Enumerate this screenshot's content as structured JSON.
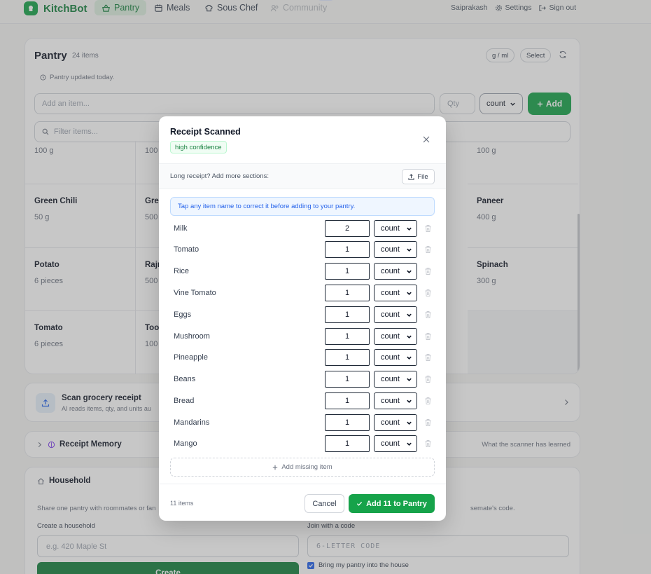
{
  "nav": {
    "brand": "KitchBot",
    "tabs": [
      {
        "label": "Pantry",
        "icon": "basket-icon"
      },
      {
        "label": "Meals",
        "icon": "calendar-icon"
      },
      {
        "label": "Sous Chef",
        "icon": "chef-hat-icon"
      },
      {
        "label": "Community",
        "icon": "users-icon",
        "badge": "soon"
      }
    ],
    "user": "Saiprakash",
    "settings": "Settings",
    "signout": "Sign out"
  },
  "pantry": {
    "title": "Pantry",
    "count": "24 items",
    "units_toggle": "g / ml",
    "select": "Select",
    "updated": "Pantry updated today.",
    "add_placeholder": "Add an item...",
    "qty_placeholder": "Qty",
    "unit_value": "count",
    "add_label": "Add",
    "filter_placeholder": "Filter items...",
    "rows": [
      [
        {
          "name": "",
          "qty": "100 g"
        },
        {
          "name": "",
          "qty": "100"
        },
        {
          "name": "",
          "qty": ""
        },
        {
          "name": "",
          "qty": ""
        },
        {
          "name": "",
          "qty": "100 g"
        }
      ],
      [
        {
          "name": "Green Chili",
          "qty": "50 g"
        },
        {
          "name": "Gre",
          "qty": "500"
        },
        {
          "name": "",
          "qty": ""
        },
        {
          "name": "",
          "qty": ""
        },
        {
          "name": "Paneer",
          "qty": "400 g"
        }
      ],
      [
        {
          "name": "Potato",
          "qty": "6 pieces"
        },
        {
          "name": "Rajr",
          "qty": "500"
        },
        {
          "name": "",
          "qty": ""
        },
        {
          "name": "",
          "qty": ""
        },
        {
          "name": "Spinach",
          "qty": "300 g"
        }
      ],
      [
        {
          "name": "Tomato",
          "qty": "6 pieces"
        },
        {
          "name": "Too",
          "qty": "100"
        },
        {
          "name": "",
          "qty": ""
        },
        {
          "name": "",
          "qty": ""
        },
        {
          "name": "",
          "qty": ""
        }
      ]
    ]
  },
  "scan": {
    "title": "Scan grocery receipt",
    "subtitle": "AI reads items, qty, and units au"
  },
  "memory": {
    "title": "Receipt Memory",
    "right": "What the scanner has learned"
  },
  "household": {
    "title": "Household",
    "desc_left": "Share one pantry with roommates or fan",
    "desc_right": "semate's code.",
    "create_label": "Create a household",
    "create_placeholder": "e.g. 420 Maple St",
    "join_label": "Join with a code",
    "join_placeholder": "6-LETTER CODE",
    "create_button": "Create",
    "bring_pantry": "Bring my pantry into the house"
  },
  "modal": {
    "title": "Receipt Scanned",
    "confidence": "high confidence",
    "more_sections": "Long receipt? Add more sections:",
    "file_button": "File",
    "hint": "Tap any item name to correct it before adding to your pantry.",
    "items": [
      {
        "name": "Milk",
        "qty": "2",
        "unit": "count"
      },
      {
        "name": "Tomato",
        "qty": "1",
        "unit": "count"
      },
      {
        "name": "Rice",
        "qty": "1",
        "unit": "count"
      },
      {
        "name": "Vine Tomato",
        "qty": "1",
        "unit": "count"
      },
      {
        "name": "Eggs",
        "qty": "1",
        "unit": "count"
      },
      {
        "name": "Mushroom",
        "qty": "1",
        "unit": "count"
      },
      {
        "name": "Pineapple",
        "qty": "1",
        "unit": "count"
      },
      {
        "name": "Beans",
        "qty": "1",
        "unit": "count"
      },
      {
        "name": "Bread",
        "qty": "1",
        "unit": "count"
      },
      {
        "name": "Mandarins",
        "qty": "1",
        "unit": "count"
      },
      {
        "name": "Mango",
        "qty": "1",
        "unit": "count"
      }
    ],
    "add_missing": "Add missing item",
    "count_text": "11 items",
    "cancel": "Cancel",
    "confirm": "Add 11 to Pantry"
  }
}
